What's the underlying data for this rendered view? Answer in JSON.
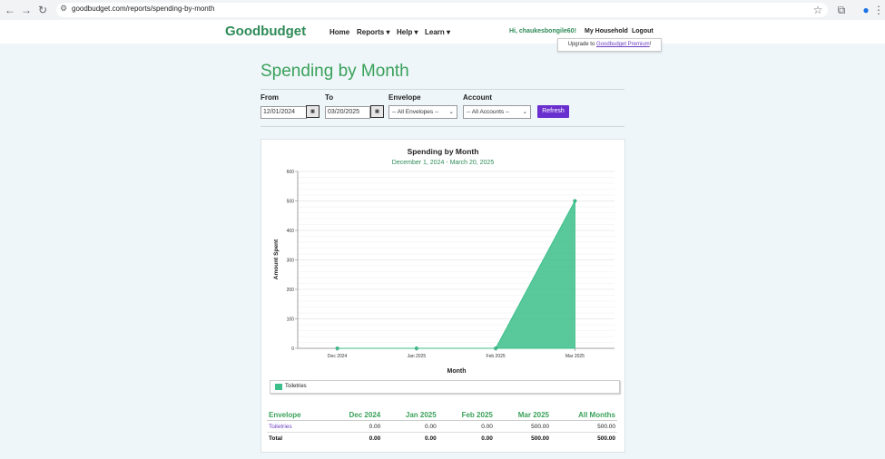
{
  "browser": {
    "url": "goodbudget.com/reports/spending-by-month",
    "icons": [
      "back-icon",
      "forward-icon",
      "reload-icon",
      "site-settings-icon",
      "bookmark-star-icon",
      "extensions-icon",
      "profile-icon",
      "menu-icon"
    ]
  },
  "nav": {
    "logo": "Goodbudget",
    "home": "Home",
    "reports": "Reports ▾",
    "help": "Help ▾",
    "learn": "Learn ▾",
    "user": "Hi, chaukesbongile60!",
    "household": "My Household",
    "logout": "Logout"
  },
  "tooltip": {
    "prefix": "Upgrade to ",
    "link": "Goodbudget Premium",
    "suffix": "!"
  },
  "page": {
    "title": "Spending by Month"
  },
  "filters": {
    "from_label": "From",
    "from_value": "12/01/2024",
    "to_label": "To",
    "to_value": "03/20/2025",
    "envelope_label": "Envelope",
    "envelope_value": "-- All Envelopes --",
    "account_label": "Account",
    "account_value": "-- All Accounts --",
    "refresh": "Refresh",
    "calendar_glyph": "▦"
  },
  "chart_data": {
    "type": "area",
    "title": "Spending by Month",
    "subtitle": "December 1, 2024 - March 20, 2025",
    "xlabel": "Month",
    "ylabel": "Amount Spent",
    "categories": [
      "Dec 2024",
      "Jan 2025",
      "Feb 2025",
      "Mar 2025"
    ],
    "series": [
      {
        "name": "Toiletries",
        "values": [
          0,
          0,
          0,
          500
        ],
        "color": "#3cbf8a"
      }
    ],
    "ylim": [
      0,
      600
    ],
    "yticks": [
      0,
      100,
      200,
      300,
      400,
      500,
      600
    ],
    "grid": true,
    "legend": "bottom"
  },
  "table": {
    "headers": [
      "Envelope",
      "Dec 2024",
      "Jan 2025",
      "Feb 2025",
      "Mar 2025",
      "All Months"
    ],
    "rows": [
      [
        "Toiletries",
        "0.00",
        "0.00",
        "0.00",
        "500.00",
        "500.00"
      ]
    ],
    "total": [
      "Total",
      "0.00",
      "0.00",
      "0.00",
      "500.00",
      "500.00"
    ]
  }
}
